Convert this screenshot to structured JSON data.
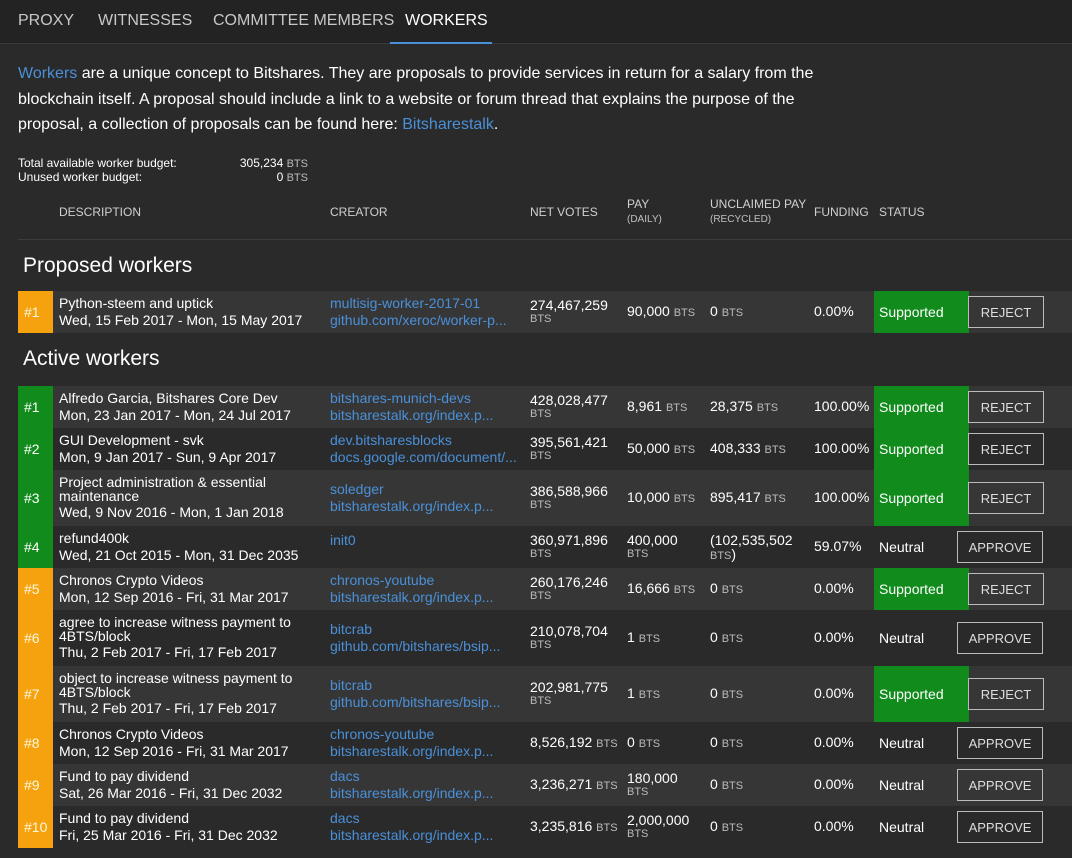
{
  "tabs": [
    {
      "label": "PROXY"
    },
    {
      "label": "WITNESSES"
    },
    {
      "label": "COMMITTEE MEMBERS"
    },
    {
      "label": "WORKERS",
      "active": true
    }
  ],
  "intro": {
    "link1": "Workers",
    "text1": " are a unique concept to Bitshares. They are proposals to provide services in return for a salary from the blockchain itself. A proposal should include a link to a website or forum thread that explains the purpose of the proposal, a collection of proposals can be found here: ",
    "link2": "Bitsharestalk",
    "text2": "."
  },
  "budget": {
    "total_label": "Total available worker budget:",
    "total_value": "305,234",
    "unused_label": "Unused worker budget:",
    "unused_value": "0",
    "unit": "BTS"
  },
  "headers": {
    "description": "DESCRIPTION",
    "creator": "CREATOR",
    "net_votes": "NET VOTES",
    "pay": "PAY",
    "pay_sub": "(DAILY)",
    "unclaimed": "UNCLAIMED PAY",
    "unclaimed_sub": "(RECYCLED)",
    "funding": "FUNDING",
    "status": "STATUS"
  },
  "proposed_title": "Proposed workers",
  "active_title": "Active workers",
  "unit": "BTS",
  "proposed": [
    {
      "rank": "#1",
      "rank_color": "orange",
      "title": "Python-steem and uptick",
      "dates": "Wed, 15 Feb 2017 - Mon, 15 May 2017",
      "creator": "multisig-worker-2017-01",
      "url": "github.com/xeroc/worker-p...",
      "votes": "274,467,259",
      "pay": "90,000",
      "unclaimed": "0",
      "funding": "0.00%",
      "status": "Supported",
      "action": "REJECT"
    }
  ],
  "active": [
    {
      "rank": "#1",
      "rank_color": "green",
      "title": "Alfredo Garcia, Bitshares Core Dev",
      "dates": "Mon, 23 Jan 2017 - Mon, 24 Jul 2017",
      "creator": "bitshares-munich-devs",
      "url": "bitsharestalk.org/index.p...",
      "votes": "428,028,477",
      "pay": "8,961",
      "unclaimed": "28,375",
      "funding": "100.00%",
      "status": "Supported",
      "action": "REJECT"
    },
    {
      "rank": "#2",
      "rank_color": "green",
      "title": "GUI Development - svk",
      "dates": "Mon, 9 Jan 2017 - Sun, 9 Apr 2017",
      "creator": "dev.bitsharesblocks",
      "url": "docs.google.com/document/...",
      "votes": "395,561,421",
      "pay": "50,000",
      "unclaimed": "408,333",
      "funding": "100.00%",
      "status": "Supported",
      "action": "REJECT"
    },
    {
      "rank": "#3",
      "rank_color": "green",
      "title": "Project administration & essential maintenance",
      "dates": "Wed, 9 Nov 2016 - Mon, 1 Jan 2018",
      "creator": "soledger",
      "url": "bitsharestalk.org/index.p...",
      "votes": "386,588,966",
      "pay": "10,000",
      "unclaimed": "895,417",
      "funding": "100.00%",
      "status": "Supported",
      "action": "REJECT"
    },
    {
      "rank": "#4",
      "rank_color": "green",
      "title": "refund400k",
      "dates": "Wed, 21 Oct 2015 - Mon, 31 Dec 2035",
      "creator": "init0",
      "url": "",
      "votes": "360,971,896",
      "pay": "400,000",
      "unclaimed": "(102,535,502",
      "unclaimed_suffix": ")",
      "funding": "59.07%",
      "status": "Neutral",
      "action": "APPROVE"
    },
    {
      "rank": "#5",
      "rank_color": "orange",
      "title": "Chronos Crypto Videos",
      "dates": "Mon, 12 Sep 2016 - Fri, 31 Mar 2017",
      "creator": "chronos-youtube",
      "url": "bitsharestalk.org/index.p...",
      "votes": "260,176,246",
      "pay": "16,666",
      "unclaimed": "0",
      "funding": "0.00%",
      "status": "Supported",
      "action": "REJECT"
    },
    {
      "rank": "#6",
      "rank_color": "orange",
      "title": "agree to increase witness payment to 4BTS/block",
      "dates": "Thu, 2 Feb 2017 - Fri, 17 Feb 2017",
      "creator": "bitcrab",
      "url": "github.com/bitshares/bsip...",
      "votes": "210,078,704",
      "pay": "1",
      "unclaimed": "0",
      "funding": "0.00%",
      "status": "Neutral",
      "action": "APPROVE"
    },
    {
      "rank": "#7",
      "rank_color": "orange",
      "title": "object to increase witness payment to 4BTS/block",
      "dates": "Thu, 2 Feb 2017 - Fri, 17 Feb 2017",
      "creator": "bitcrab",
      "url": "github.com/bitshares/bsip...",
      "votes": "202,981,775",
      "pay": "1",
      "unclaimed": "0",
      "funding": "0.00%",
      "status": "Supported",
      "action": "REJECT"
    },
    {
      "rank": "#8",
      "rank_color": "orange",
      "title": "Chronos Crypto Videos",
      "dates": "Mon, 12 Sep 2016 - Fri, 31 Mar 2017",
      "creator": "chronos-youtube",
      "url": "bitsharestalk.org/index.p...",
      "votes": "8,526,192",
      "pay": "0",
      "unclaimed": "0",
      "funding": "0.00%",
      "status": "Neutral",
      "action": "APPROVE"
    },
    {
      "rank": "#9",
      "rank_color": "orange",
      "title": "Fund to pay dividend",
      "dates": "Sat, 26 Mar 2016 - Fri, 31 Dec 2032",
      "creator": "dacs",
      "url": "bitsharestalk.org/index.p...",
      "votes": "3,236,271",
      "pay": "180,000",
      "unclaimed": "0",
      "funding": "0.00%",
      "status": "Neutral",
      "action": "APPROVE"
    },
    {
      "rank": "#10",
      "rank_color": "orange",
      "title": "Fund to pay dividend",
      "dates": "Fri, 25 Mar 2016 - Fri, 31 Dec 2032",
      "creator": "dacs",
      "url": "bitsharestalk.org/index.p...",
      "votes": "3,235,816",
      "pay": "2,000,000",
      "unclaimed": "0",
      "funding": "0.00%",
      "status": "Neutral",
      "action": "APPROVE"
    }
  ]
}
